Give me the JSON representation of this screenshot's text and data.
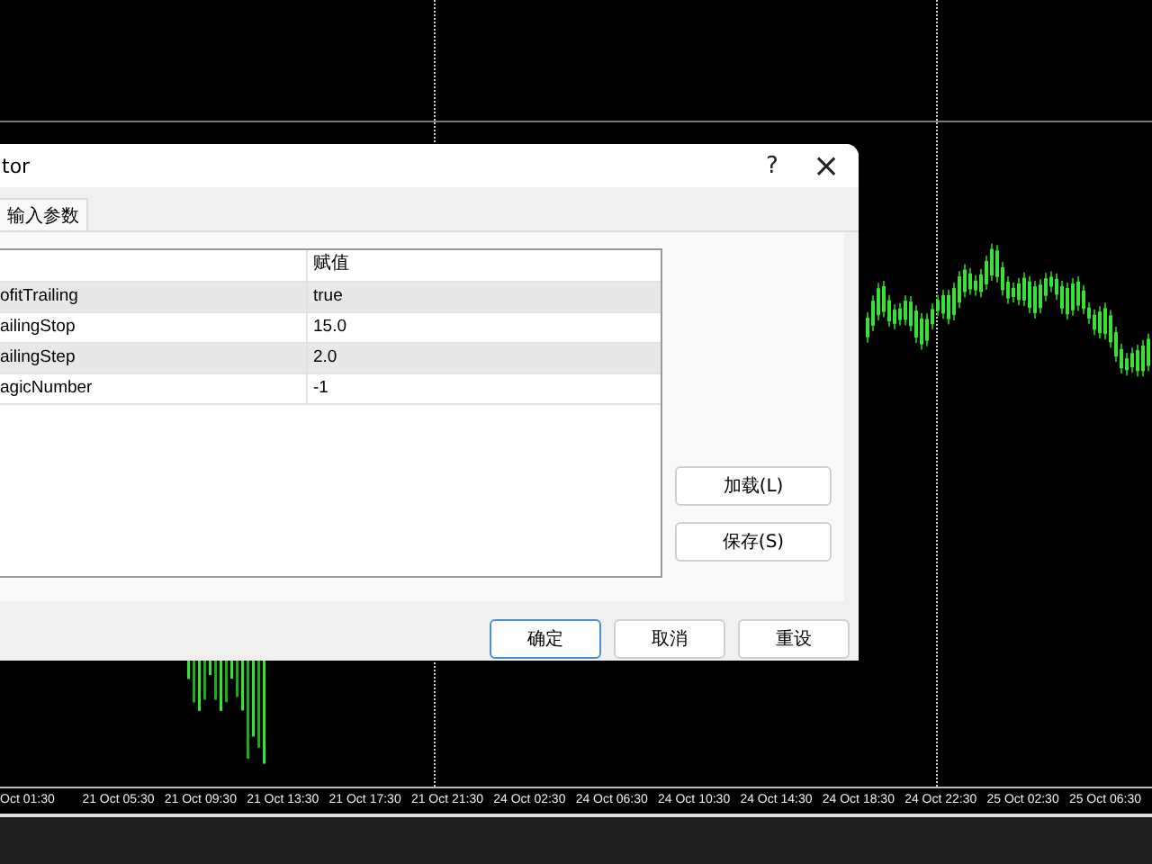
{
  "dialog": {
    "title": "tor",
    "help": "?",
    "close": "×",
    "tabs": [
      {
        "label": "输入参数",
        "selected": true
      }
    ],
    "table": {
      "columns": [
        "",
        "赋值"
      ],
      "rows": [
        {
          "name": "ofitTrailing",
          "value": "true"
        },
        {
          "name": "ailingStop",
          "value": "15.0"
        },
        {
          "name": "ailingStep",
          "value": "2.0"
        },
        {
          "name": "agicNumber",
          "value": "-1"
        }
      ]
    },
    "side_buttons": [
      "加载(L)",
      "保存(S)"
    ],
    "buttons": [
      {
        "label": "确定",
        "default": true
      },
      {
        "label": "取消",
        "default": false
      },
      {
        "label": "重设",
        "default": false
      }
    ]
  },
  "time_axis": [
    "Oct 01:30",
    "21 Oct 05:30",
    "21 Oct 09:30",
    "21 Oct 13:30",
    "21 Oct 17:30",
    "21 Oct 21:30",
    "24 Oct 02:30",
    "24 Oct 06:30",
    "24 Oct 10:30",
    "24 Oct 14:30",
    "24 Oct 18:30",
    "24 Oct 22:30",
    "25 Oct 02:30",
    "25 Oct 06:30"
  ]
}
